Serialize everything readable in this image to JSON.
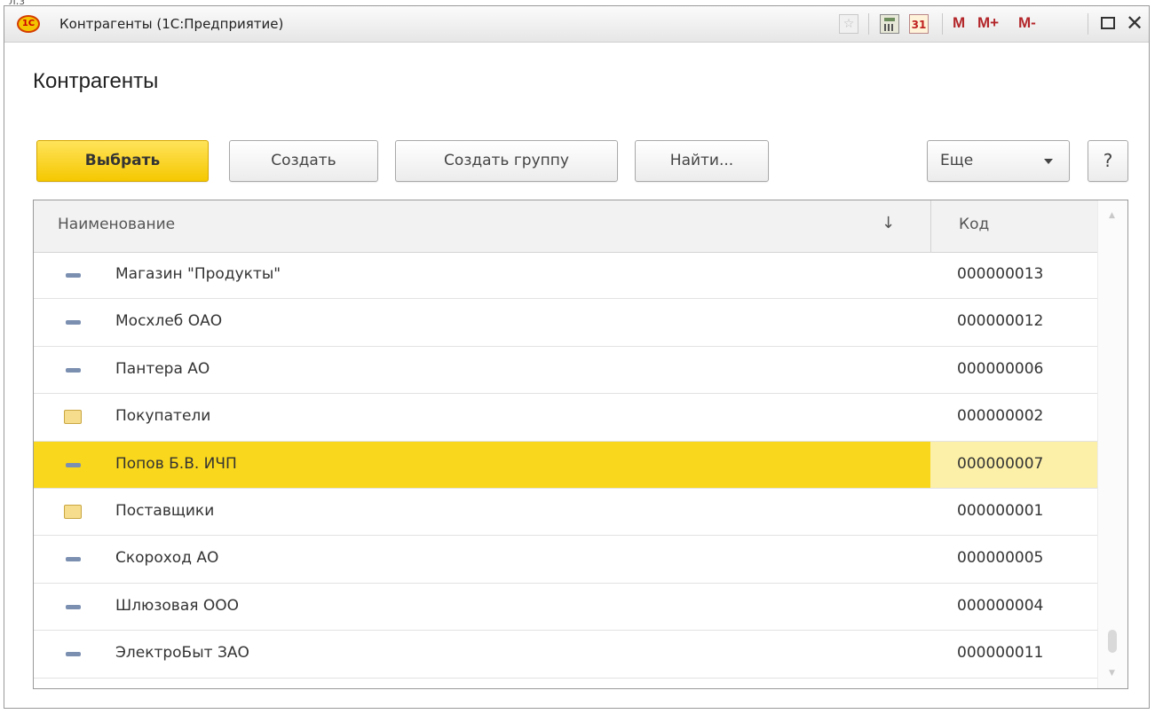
{
  "corner_text": "л.з",
  "window": {
    "title": "Контрагенты (1С:Предприятие)",
    "logo_text": "1С",
    "calendar_day": "31",
    "memory_buttons": [
      "M",
      "M+",
      "M-"
    ],
    "close_glyph": "✕"
  },
  "page": {
    "title": "Контрагенты"
  },
  "toolbar": {
    "select_label": "Выбрать",
    "create_label": "Создать",
    "create_group_label": "Создать группу",
    "find_label": "Найти...",
    "more_label": "Еще",
    "help_label": "?"
  },
  "table": {
    "columns": {
      "name": "Наименование",
      "code": "Код",
      "sort_indicator": "↓"
    },
    "rows": [
      {
        "icon": "item-icon",
        "name": "Магазин \"Продукты\"",
        "code": "000000013"
      },
      {
        "icon": "item-icon",
        "name": "Мосхлеб ОАО",
        "code": "000000012"
      },
      {
        "icon": "item-icon",
        "name": "Пантера АО",
        "code": "000000006"
      },
      {
        "icon": "folder-icon",
        "name": "Покупатели",
        "code": "000000002"
      },
      {
        "icon": "item-icon",
        "name": "Попов Б.В. ИЧП",
        "code": "000000007",
        "selected": true
      },
      {
        "icon": "folder-icon",
        "name": "Поставщики",
        "code": "000000001"
      },
      {
        "icon": "item-icon",
        "name": "Скороход АО",
        "code": "000000005"
      },
      {
        "icon": "item-icon",
        "name": "Шлюзовая ООО",
        "code": "000000004"
      },
      {
        "icon": "item-icon",
        "name": "ЭлектроБыт ЗАО",
        "code": "000000011"
      }
    ]
  },
  "colors": {
    "selected_row": "#f9d71c",
    "selected_code_cell": "#fcf0a8",
    "primary_button": "#f5c800",
    "memory_buttons": "#b3262a"
  }
}
